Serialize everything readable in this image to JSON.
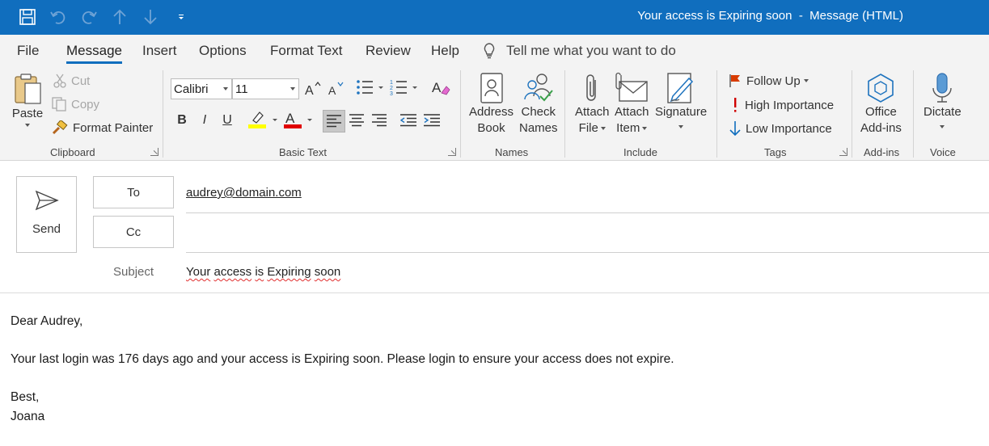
{
  "window": {
    "title": "Your access is Expiring soon  -  Message (HTML)"
  },
  "quick_access": {
    "icons": [
      "save-icon",
      "undo-icon",
      "redo-icon",
      "up-arrow-icon",
      "down-arrow-icon",
      "customize-icon"
    ]
  },
  "tabs": [
    "File",
    "Message",
    "Insert",
    "Options",
    "Format Text",
    "Review",
    "Help"
  ],
  "active_tab": "Message",
  "tell_me": "Tell me what you want to do",
  "ribbon": {
    "clipboard": {
      "label": "Clipboard",
      "paste": "Paste",
      "cut": "Cut",
      "copy": "Copy",
      "format_painter": "Format Painter"
    },
    "basic_text": {
      "label": "Basic Text",
      "font": "Calibri",
      "size": "11",
      "bold": "B",
      "italic": "I",
      "underline": "U"
    },
    "names": {
      "label": "Names",
      "address_book_1": "Address",
      "address_book_2": "Book",
      "check_names_1": "Check",
      "check_names_2": "Names"
    },
    "include": {
      "label": "Include",
      "attach_file_1": "Attach",
      "attach_file_2": "File",
      "attach_item_1": "Attach",
      "attach_item_2": "Item",
      "signature": "Signature"
    },
    "tags": {
      "label": "Tags",
      "follow_up": "Follow Up",
      "high_importance": "High Importance",
      "low_importance": "Low Importance"
    },
    "addins": {
      "label": "Add-ins",
      "office_1": "Office",
      "office_2": "Add-ins"
    },
    "voice": {
      "label": "Voice",
      "dictate": "Dictate"
    }
  },
  "message": {
    "send": "Send",
    "to_label": "To",
    "cc_label": "Cc",
    "to_value": "audrey@domain.com",
    "cc_value": "",
    "subject_label": "Subject",
    "subject_words": [
      "Your",
      "access",
      "is",
      "Expiring",
      "soon"
    ],
    "body": {
      "greeting": "Dear Audrey,",
      "paragraph": "Your last login was 176 days ago and your access is Expiring soon. Please login to ensure your access does not expire.",
      "closing": "Best,",
      "signature": "Joana"
    }
  },
  "colors": {
    "titlebar": "#106ebe",
    "highlight": "#ffff00",
    "font_color": "#e00000",
    "follow_up_flag": "#d83b01",
    "high_importance": "#d00000",
    "low_importance": "#106ebe",
    "accent_icon": "#1e73be"
  }
}
